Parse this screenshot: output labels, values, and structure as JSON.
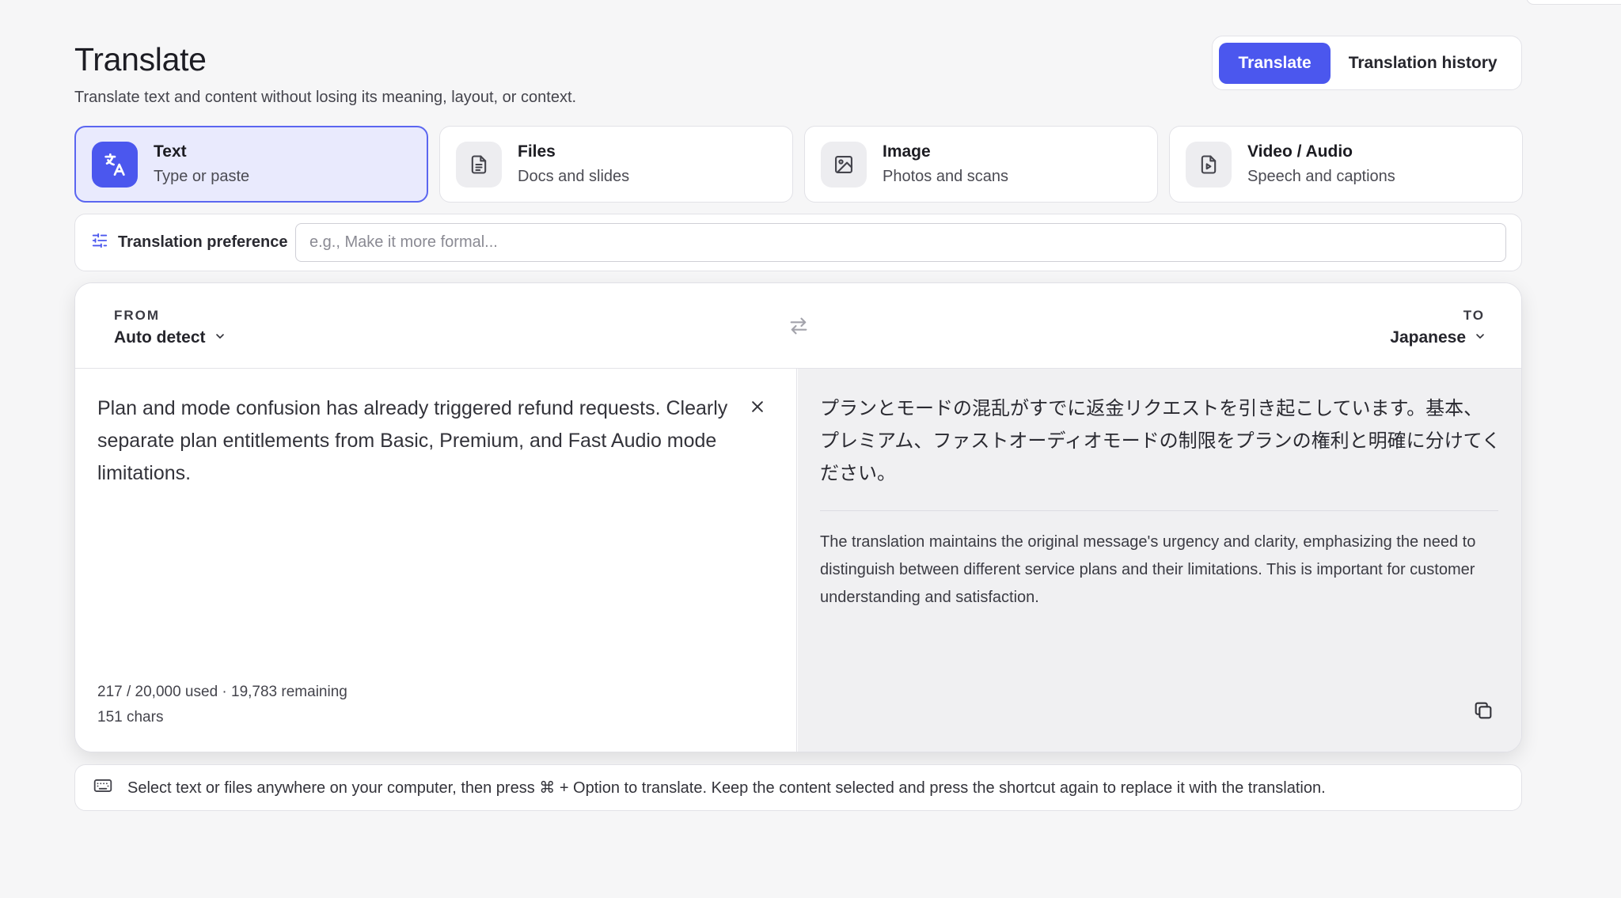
{
  "header": {
    "title": "Translate",
    "subtitle": "Translate text and content without losing its meaning, layout, or context."
  },
  "mode_toggle": {
    "translate_label": "Translate",
    "history_label": "Translation history",
    "accent": "#4b57ee"
  },
  "input_types": [
    {
      "title": "Text",
      "desc": "Type or paste",
      "icon": "translate-icon",
      "active": true
    },
    {
      "title": "Files",
      "desc": "Docs and slides",
      "icon": "document-icon",
      "active": false
    },
    {
      "title": "Image",
      "desc": "Photos and scans",
      "icon": "image-icon",
      "active": false
    },
    {
      "title": "Video / Audio",
      "desc": "Speech and captions",
      "icon": "video-file-icon",
      "active": false
    }
  ],
  "preference": {
    "label": "Translation preference",
    "placeholder": "e.g., Make it more formal..."
  },
  "languages": {
    "from_caption": "FROM",
    "from_value": "Auto detect",
    "to_caption": "TO",
    "to_value": "Japanese"
  },
  "source": {
    "text": "Plan and mode confusion has already triggered refund requests. Clearly separate plan entitlements from Basic, Premium, and Fast Audio mode limitations.",
    "usage": "217 / 20,000 used  ·  19,783 remaining",
    "chars": "151 chars"
  },
  "target": {
    "text": "プランとモードの混乱がすでに返金リクエストを引き起こしています。基本、プレミアム、ファストオーディオモードの制限をプランの権利と明確に分けてください。",
    "note": "The translation maintains the original message's urgency and clarity, emphasizing the need to distinguish between different service plans and their limitations. This is important for customer understanding and satisfaction."
  },
  "tip": {
    "text": "Select text or files anywhere on your computer, then press ⌘ + Option to translate. Keep the content selected and press the shortcut again to replace it with the translation."
  }
}
